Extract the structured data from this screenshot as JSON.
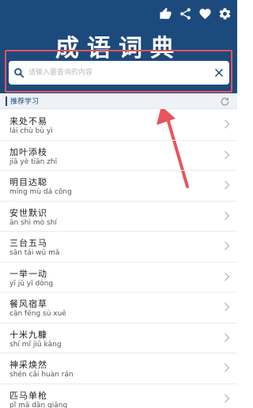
{
  "app": {
    "title": "成语词典"
  },
  "toolbar": {
    "icons": [
      "thumbs-up-icon",
      "share-icon",
      "heart-icon",
      "gear-icon"
    ]
  },
  "search": {
    "placeholder": "请输入要查询的内容",
    "value": ""
  },
  "section": {
    "label": "推荐学习"
  },
  "colors": {
    "header": "#1d4a7d",
    "annotation": "#e8545a"
  },
  "idioms": [
    {
      "title": "来处不易",
      "pinyin": "lái chù bù yì"
    },
    {
      "title": "加叶添枝",
      "pinyin": "jiā yè tiān zhī"
    },
    {
      "title": "明目达聪",
      "pinyin": "míng mù dá cōng"
    },
    {
      "title": "安世默识",
      "pinyin": "ān shì mò shí"
    },
    {
      "title": "三台五马",
      "pinyin": "sān tái wǔ mǎ"
    },
    {
      "title": "一举一动",
      "pinyin": "yī jǔ yī dòng"
    },
    {
      "title": "餐风宿草",
      "pinyin": "cān fēng sù xuē"
    },
    {
      "title": "十米九糠",
      "pinyin": "shí mǐ jiǔ kāng"
    },
    {
      "title": "神采焕然",
      "pinyin": "shén cǎi huàn rán"
    },
    {
      "title": "匹马单枪",
      "pinyin": "pǐ mǎ dān qiāng"
    }
  ]
}
